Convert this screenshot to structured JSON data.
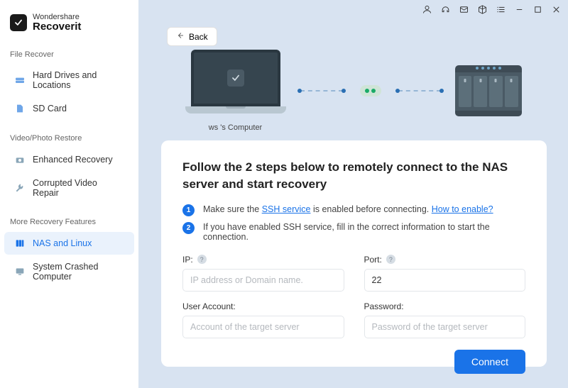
{
  "brand": {
    "line1": "Wondershare",
    "line2": "Recoverit"
  },
  "sidebar": {
    "sections": [
      {
        "label": "File Recover",
        "items": [
          {
            "label": "Hard Drives and Locations",
            "icon": "hdd-icon"
          },
          {
            "label": "SD Card",
            "icon": "sdcard-icon"
          }
        ]
      },
      {
        "label": "Video/Photo Restore",
        "items": [
          {
            "label": "Enhanced Recovery",
            "icon": "camera-icon"
          },
          {
            "label": "Corrupted Video Repair",
            "icon": "wrench-icon"
          }
        ]
      },
      {
        "label": "More Recovery Features",
        "items": [
          {
            "label": "NAS and Linux",
            "icon": "nas-icon",
            "active": true
          },
          {
            "label": "System Crashed Computer",
            "icon": "monitor-icon"
          }
        ]
      }
    ]
  },
  "back_label": "Back",
  "illustration": {
    "computer_label": "ws 's Computer"
  },
  "panel": {
    "heading": "Follow the 2 steps below to remotely connect to the NAS server and start recovery",
    "steps": [
      {
        "pre": "Make sure the ",
        "link1": "SSH service",
        "mid": " is enabled before connecting. ",
        "link2": "How to enable?"
      },
      {
        "text": "If you have enabled SSH service, fill in the correct information to start the connection."
      }
    ],
    "fields": {
      "ip": {
        "label": "IP:",
        "placeholder": "IP address or Domain name.",
        "value": ""
      },
      "port": {
        "label": "Port:",
        "placeholder": "",
        "value": "22"
      },
      "user": {
        "label": "User Account:",
        "placeholder": "Account of the target server",
        "value": ""
      },
      "password": {
        "label": "Password:",
        "placeholder": "Password of the target server",
        "value": ""
      }
    },
    "connect_label": "Connect"
  }
}
